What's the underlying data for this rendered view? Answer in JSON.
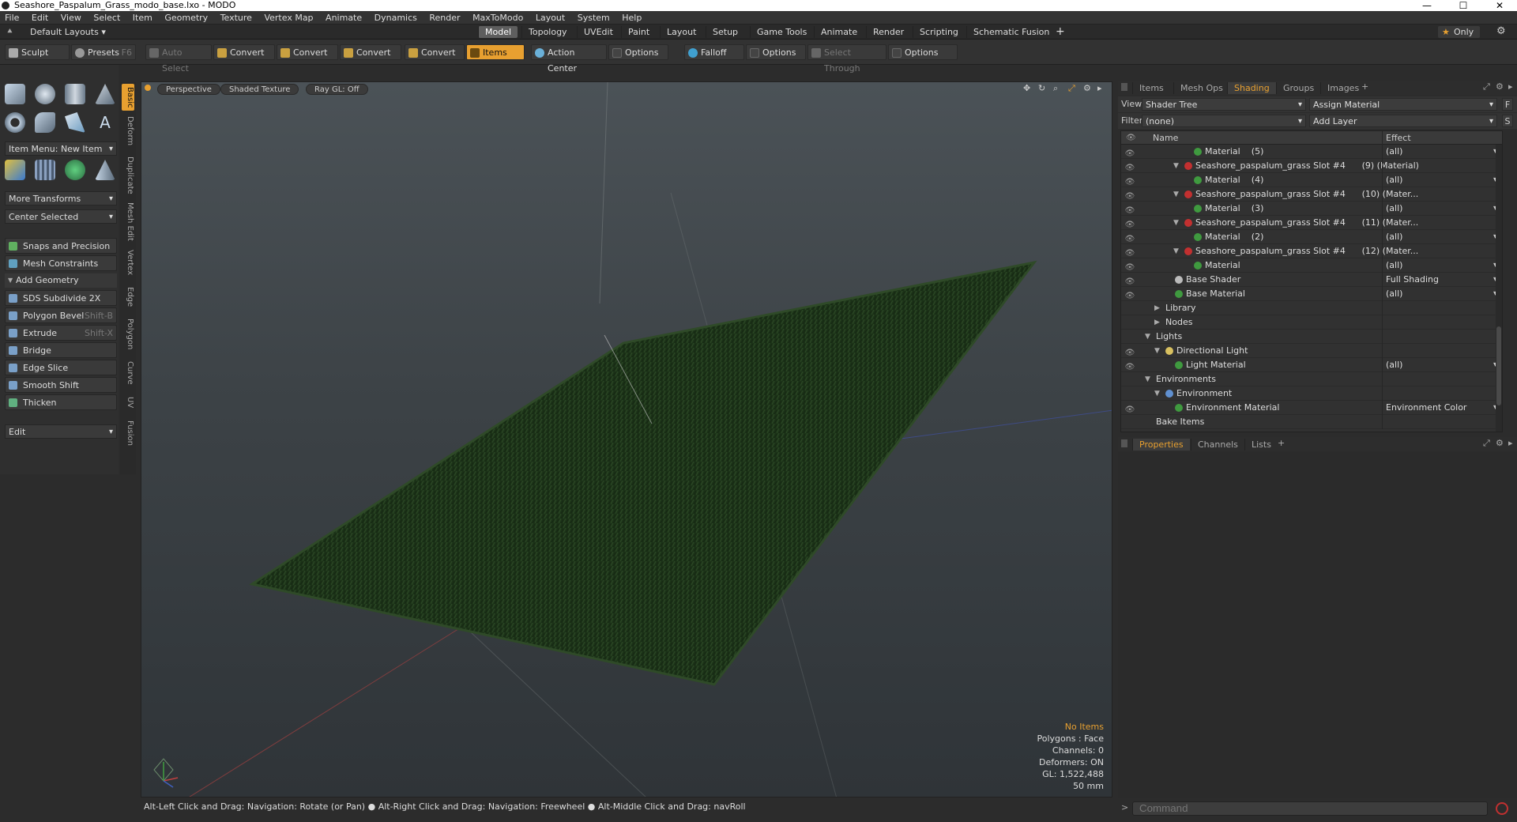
{
  "window": {
    "title": "Seashore_Paspalum_Grass_modo_base.lxo - MODO"
  },
  "menu": [
    "File",
    "Edit",
    "View",
    "Select",
    "Item",
    "Geometry",
    "Texture",
    "Vertex Map",
    "Animate",
    "Dynamics",
    "Render",
    "MaxToModo",
    "Layout",
    "System",
    "Help"
  ],
  "layouts": {
    "selector": "Default Layouts",
    "tabs": [
      "Model",
      "Topology",
      "UVEdit",
      "Paint",
      "Layout",
      "Setup",
      "Game Tools",
      "Animate",
      "Render",
      "Scripting",
      "Schematic Fusion"
    ],
    "active": "Model",
    "add": "+",
    "only": "Only"
  },
  "toolbar": {
    "sculpt": "Sculpt",
    "presets": "Presets",
    "presets_key": "F6",
    "auto_select": "Auto Select",
    "convert1": "Convert",
    "convert2": "Convert",
    "convert3": "Convert",
    "convert4": "Convert",
    "items": "Items",
    "action_center": "Action Center",
    "options1": "Options",
    "falloff": "Falloff",
    "options2": "Options",
    "select_through": "Select Through",
    "options3": "Options"
  },
  "left": {
    "item_menu": "Item Menu: New Item",
    "more_transforms": "More Transforms",
    "center_selected": "Center Selected",
    "snaps": "Snaps and Precision",
    "mesh_constraints": "Mesh Constraints",
    "add_geometry": "Add Geometry",
    "tools": [
      {
        "label": "SDS Subdivide 2X",
        "key": ""
      },
      {
        "label": "Polygon Bevel",
        "key": "Shift-B"
      },
      {
        "label": "Extrude",
        "key": "Shift-X"
      },
      {
        "label": "Bridge",
        "key": ""
      },
      {
        "label": "Edge Slice",
        "key": ""
      },
      {
        "label": "Smooth Shift",
        "key": ""
      },
      {
        "label": "Thicken",
        "key": ""
      }
    ],
    "edit": "Edit",
    "vtabs": [
      "Basic",
      "Deform",
      "Duplicate",
      "Mesh Edit",
      "Vertex",
      "Edge",
      "Polygon",
      "Curve",
      "UV",
      "Fusion"
    ]
  },
  "viewport": {
    "perspective": "Perspective",
    "shading": "Shaded Texture",
    "raygl": "Ray GL: Off",
    "stats": {
      "items": "No Items",
      "polygons": "Polygons : Face",
      "channels": "Channels: 0",
      "deformers": "Deformers: ON",
      "gl": "GL: 1,522,488",
      "lens": "50 mm"
    }
  },
  "status": "Alt-Left Click and Drag: Navigation: Rotate (or Pan) ● Alt-Right Click and Drag: Navigation: Freewheel ● Alt-Middle Click and Drag: navRoll",
  "right": {
    "tabs": [
      "Items",
      "Mesh Ops",
      "Shading",
      "Groups",
      "Images"
    ],
    "active_tab": "Shading",
    "view_label": "View",
    "view_value": "Shader Tree",
    "assign_material": "Assign Material",
    "f_btn": "F",
    "filter_label": "Filter",
    "filter_value": "(none)",
    "add_layer": "Add Layer",
    "s_btn": "S",
    "col_name": "Name",
    "col_effect": "Effect",
    "rows": [
      {
        "name": "Material",
        "obj": "(5)",
        "effect": "(all)",
        "indent": 4,
        "dot": "#3f9a3f",
        "tri": "",
        "eye": true
      },
      {
        "name": "Seashore_paspalum_grass Slot #4",
        "obj": "(9) (Material)",
        "effect": "",
        "indent": 3,
        "dot": "#c23030",
        "tri": "▼",
        "eye": true
      },
      {
        "name": "Material",
        "obj": "(4)",
        "effect": "(all)",
        "indent": 4,
        "dot": "#3f9a3f",
        "tri": "",
        "eye": true
      },
      {
        "name": "Seashore_paspalum_grass Slot #4",
        "obj": "(10) (Mater...",
        "effect": "",
        "indent": 3,
        "dot": "#c23030",
        "tri": "▼",
        "eye": true
      },
      {
        "name": "Material",
        "obj": "(3)",
        "effect": "(all)",
        "indent": 4,
        "dot": "#3f9a3f",
        "tri": "",
        "eye": true
      },
      {
        "name": "Seashore_paspalum_grass Slot #4",
        "obj": "(11) (Mater...",
        "effect": "",
        "indent": 3,
        "dot": "#c23030",
        "tri": "▼",
        "eye": true
      },
      {
        "name": "Material",
        "obj": "(2)",
        "effect": "(all)",
        "indent": 4,
        "dot": "#3f9a3f",
        "tri": "",
        "eye": true
      },
      {
        "name": "Seashore_paspalum_grass Slot #4",
        "obj": "(12) (Mater...",
        "effect": "",
        "indent": 3,
        "dot": "#c23030",
        "tri": "▼",
        "eye": true
      },
      {
        "name": "Material",
        "obj": "",
        "effect": "(all)",
        "indent": 4,
        "dot": "#3f9a3f",
        "tri": "",
        "eye": true
      },
      {
        "name": "Base Shader",
        "obj": "",
        "effect": "Full Shading",
        "indent": 2,
        "dot": "#bbbbbb",
        "tri": "",
        "eye": true
      },
      {
        "name": "Base Material",
        "obj": "",
        "effect": "(all)",
        "indent": 2,
        "dot": "#3f9a3f",
        "tri": "",
        "eye": true
      },
      {
        "name": "Library",
        "obj": "",
        "effect": "",
        "indent": 1,
        "dot": "",
        "tri": "▶",
        "eye": false
      },
      {
        "name": "Nodes",
        "obj": "",
        "effect": "",
        "indent": 1,
        "dot": "",
        "tri": "▶",
        "eye": false
      },
      {
        "name": "Lights",
        "obj": "",
        "effect": "",
        "indent": 0,
        "dot": "",
        "tri": "▼",
        "eye": false
      },
      {
        "name": "Directional Light",
        "obj": "",
        "effect": "",
        "indent": 1,
        "dot": "#d8c060",
        "tri": "▼",
        "eye": true
      },
      {
        "name": "Light Material",
        "obj": "",
        "effect": "(all)",
        "indent": 2,
        "dot": "#3f9a3f",
        "tri": "",
        "eye": true
      },
      {
        "name": "Environments",
        "obj": "",
        "effect": "",
        "indent": 0,
        "dot": "",
        "tri": "▼",
        "eye": false
      },
      {
        "name": "Environment",
        "obj": "",
        "effect": "",
        "indent": 1,
        "dot": "#6090d0",
        "tri": "▼",
        "eye": false
      },
      {
        "name": "Environment Material",
        "obj": "",
        "effect": "Environment Color",
        "indent": 2,
        "dot": "#3f9a3f",
        "tri": "",
        "eye": true
      },
      {
        "name": "Bake Items",
        "obj": "",
        "effect": "",
        "indent": 0,
        "dot": "",
        "tri": "",
        "eye": false
      }
    ],
    "prop_tabs": [
      "Properties",
      "Channels",
      "Lists"
    ],
    "command_placeholder": "Command"
  }
}
